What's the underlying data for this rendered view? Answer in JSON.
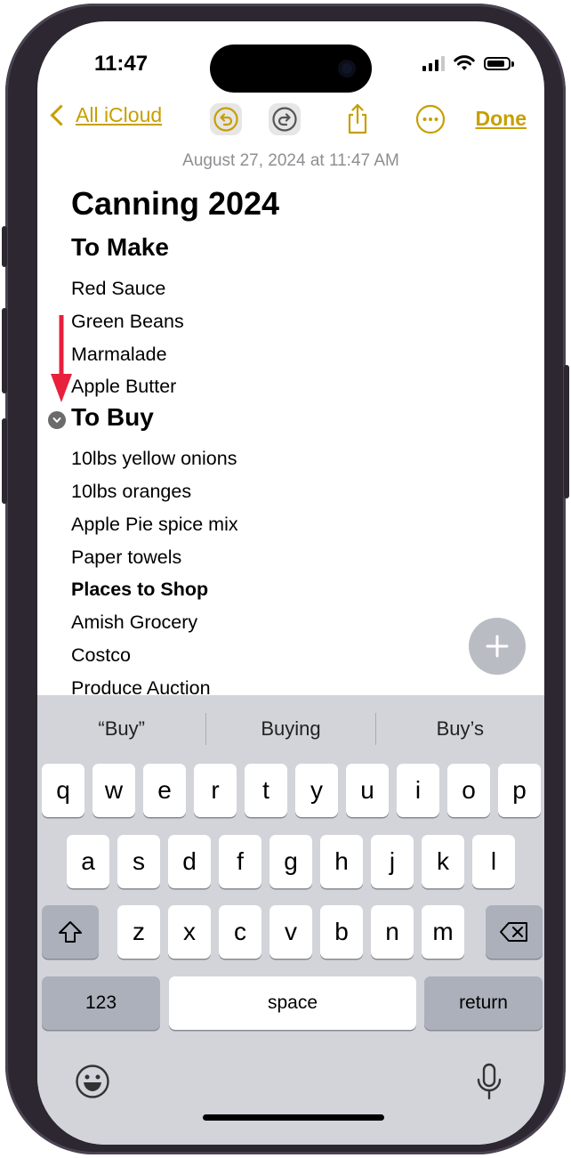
{
  "status": {
    "time": "11:47"
  },
  "toolbar": {
    "back_label": "All iCloud",
    "done_label": "Done"
  },
  "note": {
    "date": "August 27, 2024 at 11:47 AM",
    "title": "Canning 2024",
    "section1": "To Make",
    "make_items": [
      "Red Sauce",
      "Green Beans",
      "Marmalade",
      "Apple Butter"
    ],
    "section2": "To Buy",
    "buy_items": [
      "10lbs yellow onions",
      "10lbs oranges",
      "Apple Pie spice mix",
      "Paper towels"
    ],
    "places_heading": "Places to Shop",
    "places": [
      "Amish Grocery",
      "Costco",
      "Produce Auction"
    ]
  },
  "keyboard": {
    "suggestions": [
      "“Buy”",
      "Buying",
      "Buy’s"
    ],
    "row1": [
      "q",
      "w",
      "e",
      "r",
      "t",
      "y",
      "u",
      "i",
      "o",
      "p"
    ],
    "row2": [
      "a",
      "s",
      "d",
      "f",
      "g",
      "h",
      "j",
      "k",
      "l"
    ],
    "row3": [
      "z",
      "x",
      "c",
      "v",
      "b",
      "n",
      "m"
    ],
    "numbers_label": "123",
    "space_label": "space",
    "return_label": "return"
  },
  "colors": {
    "accent": "#c79f00",
    "arrow": "#e8203c",
    "keyboard_bg": "#d2d4da"
  },
  "icons": [
    "undo-icon",
    "redo-icon",
    "share-icon",
    "more-icon",
    "collapse-chevron-icon",
    "add-icon",
    "shift-icon",
    "delete-icon",
    "emoji-icon",
    "microphone-icon"
  ]
}
